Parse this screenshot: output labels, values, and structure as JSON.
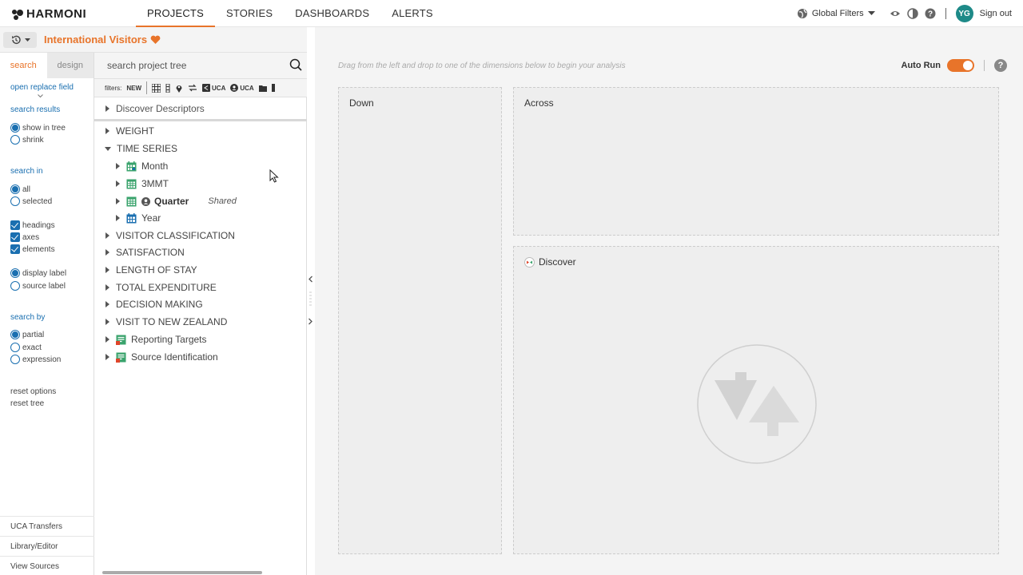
{
  "app": {
    "logo": "HARMONI"
  },
  "nav": {
    "items": [
      "PROJECTS",
      "STORIES",
      "DASHBOARDS",
      "ALERTS"
    ],
    "active": "PROJECTS"
  },
  "topright": {
    "global_filters": "Global Filters",
    "avatar_initials": "YG",
    "sign_out": "Sign out"
  },
  "project": {
    "title": "International Visitors"
  },
  "options": {
    "tabs": [
      "search",
      "design"
    ],
    "open_replace": "open replace field",
    "search_results": {
      "heading": "search results",
      "options": [
        "show in tree",
        "shrink"
      ],
      "selected": "show in tree"
    },
    "search_in": {
      "heading": "search in",
      "options": [
        "all",
        "selected"
      ],
      "selected": "all"
    },
    "checkboxes": [
      "headings",
      "axes",
      "elements"
    ],
    "label_type": {
      "options": [
        "display label",
        "source label"
      ],
      "selected": "display label"
    },
    "search_by": {
      "heading": "search by",
      "options": [
        "partial",
        "exact",
        "expression"
      ],
      "selected": "partial"
    },
    "reset_options": "reset options",
    "reset_tree": "reset tree",
    "bottom_links": [
      "UCA Transfers",
      "Library/Editor",
      "View Sources"
    ]
  },
  "tree": {
    "search_placeholder": "search project tree",
    "filters_label": "filters:",
    "filters_new": "NEW",
    "filter_uca1": "UCA",
    "filter_uca2": "UCA",
    "pinned": "Discover Descriptors",
    "items": [
      {
        "label": "WEIGHT",
        "level": 0,
        "expanded": false
      },
      {
        "label": "TIME SERIES",
        "level": 0,
        "expanded": true
      },
      {
        "label": "Month",
        "level": 1,
        "icon": "calendar-icon"
      },
      {
        "label": "3MMT",
        "level": 1,
        "icon": "grid-icon"
      },
      {
        "label": "Quarter",
        "level": 1,
        "icon": "grid-icon",
        "bold": true,
        "tag": "Shared"
      },
      {
        "label": "Year",
        "level": 1,
        "icon": "calendar-icon"
      },
      {
        "label": "VISITOR CLASSIFICATION",
        "level": 0
      },
      {
        "label": "SATISFACTION",
        "level": 0
      },
      {
        "label": "LENGTH OF STAY",
        "level": 0
      },
      {
        "label": "TOTAL EXPENDITURE",
        "level": 0
      },
      {
        "label": "DECISION MAKING",
        "level": 0
      },
      {
        "label": "VISIT TO NEW ZEALAND",
        "level": 0
      },
      {
        "label": "Reporting Targets",
        "level": 0,
        "icon": "report-icon"
      },
      {
        "label": "Source Identification",
        "level": 0,
        "icon": "report-icon"
      }
    ]
  },
  "analysis": {
    "hint": "Drag from the left and drop to one of the dimensions below to begin your analysis",
    "auto_run": "Auto Run",
    "auto_run_on": true,
    "zones": {
      "down": "Down",
      "across": "Across",
      "discover": "Discover"
    }
  },
  "colors": {
    "accent": "#e8742a",
    "link": "#1a6fb0",
    "avatar": "#1e8a88",
    "tree_icon": "#3aa36c"
  }
}
